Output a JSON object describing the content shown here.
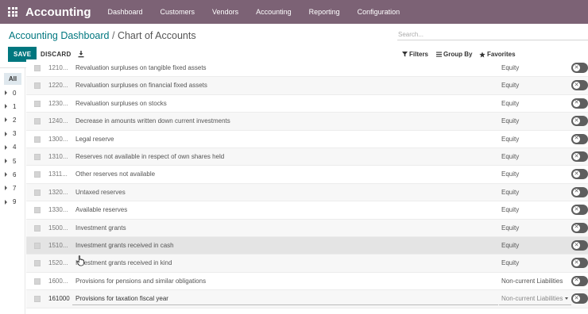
{
  "app": {
    "brand": "Accounting"
  },
  "menu": [
    "Dashboard",
    "Customers",
    "Vendors",
    "Accounting",
    "Reporting",
    "Configuration"
  ],
  "breadcrumb": {
    "parent": "Accounting Dashboard",
    "separator": "/",
    "current": "Chart of Accounts"
  },
  "search": {
    "placeholder": "Search..."
  },
  "buttons": {
    "save": "SAVE",
    "discard": "DISCARD"
  },
  "filters": {
    "filters": "Filters",
    "group_by": "Group By",
    "favorites": "Favorites"
  },
  "sidebar": {
    "all": "All",
    "items": [
      "0",
      "1",
      "2",
      "3",
      "4",
      "5",
      "6",
      "7",
      "9"
    ]
  },
  "rows": [
    {
      "code": "1210...",
      "name": "Revaluation surpluses on tangible fixed assets",
      "type": "Equity"
    },
    {
      "code": "1220...",
      "name": "Revaluation surpluses on financial fixed assets",
      "type": "Equity"
    },
    {
      "code": "1230...",
      "name": "Revaluation surpluses on stocks",
      "type": "Equity"
    },
    {
      "code": "1240...",
      "name": "Decrease in amounts written down current investments",
      "type": "Equity"
    },
    {
      "code": "1300...",
      "name": "Legal reserve",
      "type": "Equity"
    },
    {
      "code": "1310...",
      "name": "Reserves not available in respect of own shares held",
      "type": "Equity"
    },
    {
      "code": "1311...",
      "name": "Other reserves not available",
      "type": "Equity"
    },
    {
      "code": "1320...",
      "name": "Untaxed reserves",
      "type": "Equity"
    },
    {
      "code": "1330...",
      "name": "Available reserves",
      "type": "Equity"
    },
    {
      "code": "1500...",
      "name": "Investment grants",
      "type": "Equity"
    },
    {
      "code": "1510...",
      "name": "Investment grants received in cash",
      "type": "Equity"
    },
    {
      "code": "1520...",
      "name": "Investment grants received in kind",
      "type": "Equity"
    },
    {
      "code": "1600...",
      "name": "Provisions for pensions and similar obligations",
      "type": "Non-current Liabilities"
    },
    {
      "code": "161000",
      "name": "Provisions for taxation fiscal year",
      "type": "Non-current Liabilities"
    }
  ],
  "colors": {
    "topbar": "#7c6275",
    "primary": "#00777f"
  }
}
